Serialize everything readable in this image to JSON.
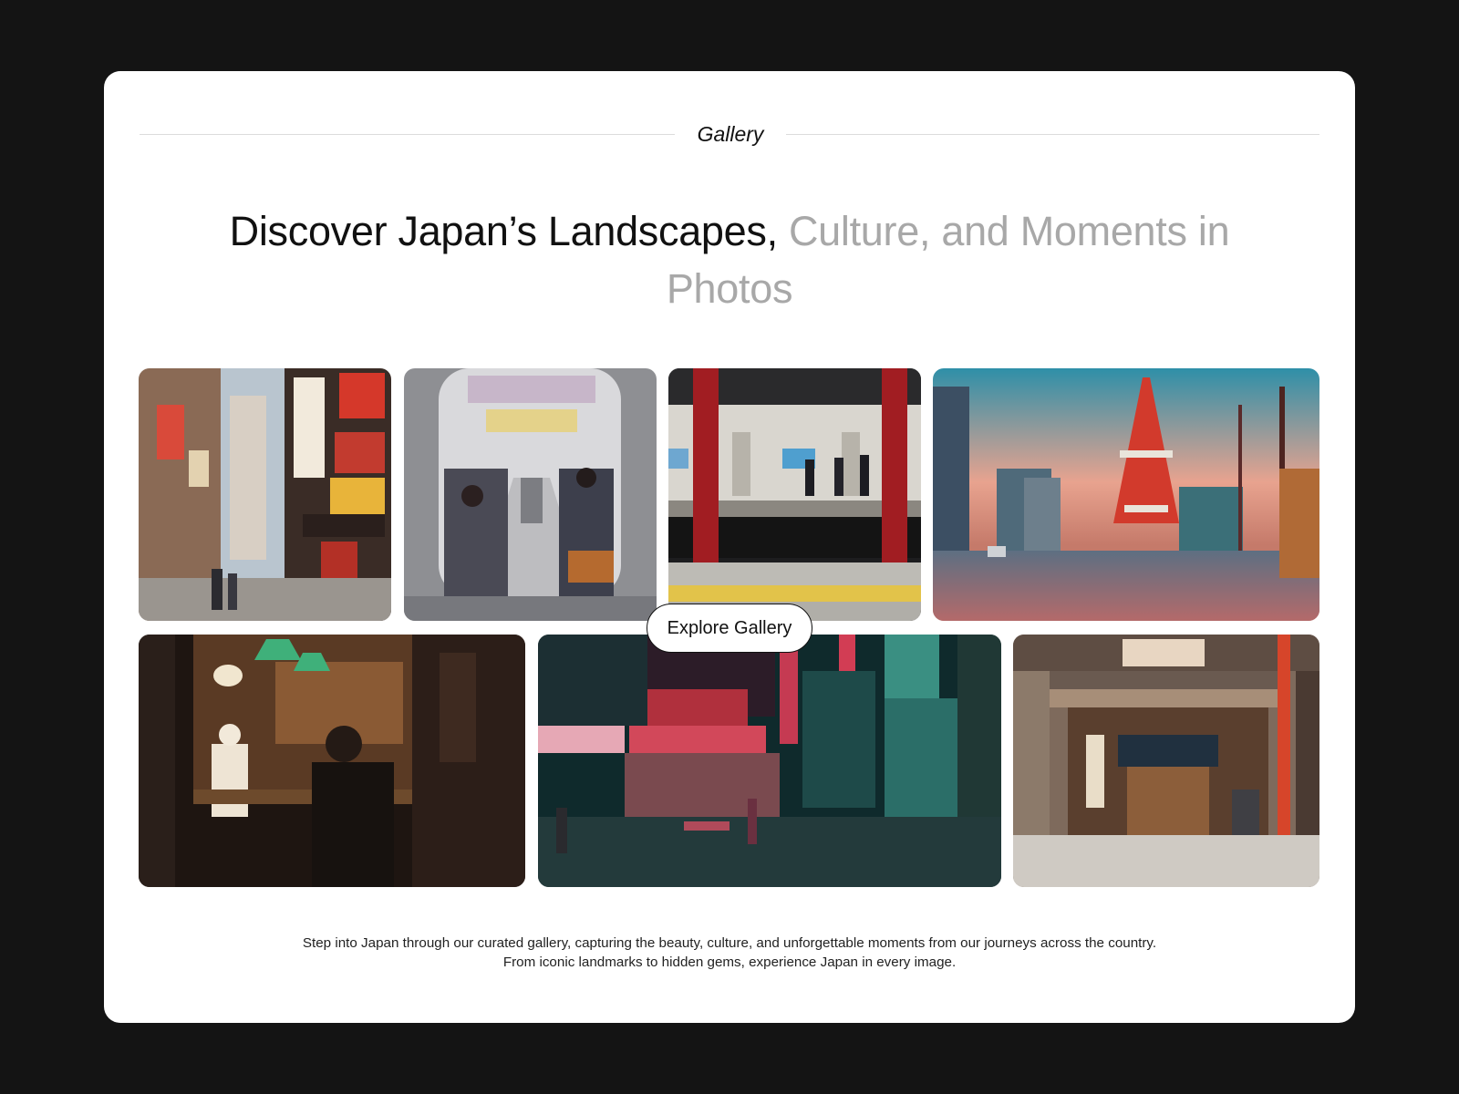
{
  "section": {
    "eyebrow": "Gallery"
  },
  "headline": {
    "dark": "Discover Japan’s Landscapes,",
    "muted": "Culture, and Moments in Photos"
  },
  "gallery": {
    "cta_label": "Explore Gallery",
    "photos": [
      "shopping-street-photo",
      "train-interior-photo",
      "subway-platform-photo",
      "tokyo-tower-sunset-photo",
      "ramen-bar-photo",
      "neon-rainy-street-photo",
      "fujiden-storefront-photo"
    ]
  },
  "description": "Step into Japan through our curated gallery, capturing the beauty, culture, and unforgettable moments from our journeys across the country. From iconic landmarks to hidden gems, experience Japan in every image.",
  "colors": {
    "page_bg": "#141414",
    "card_bg": "#ffffff",
    "text": "#111111",
    "muted_text": "#a8a8a8"
  }
}
